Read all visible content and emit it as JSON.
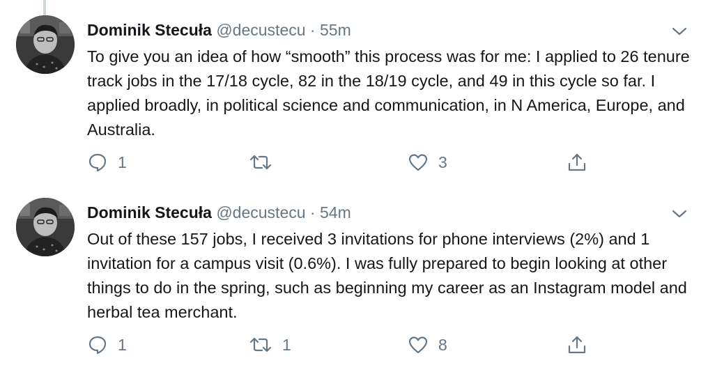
{
  "tweets": [
    {
      "author_name": "Dominik Stecuła",
      "handle": "@decustecu",
      "separator": "·",
      "time": "55m",
      "text": "To give you an idea of how “smooth” this process was for me: I applied to 26 tenure track jobs in the 17/18 cycle, 82 in the 18/19 cycle, and 49 in this cycle so far. I applied broadly, in political science and communication, in N America, Europe, and Australia.",
      "replies": "1",
      "retweets": "",
      "likes": "3"
    },
    {
      "author_name": "Dominik Stecuła",
      "handle": "@decustecu",
      "separator": "·",
      "time": "54m",
      "text": "Out of these 157 jobs, I received 3 invitations for phone interviews (2%) and 1 invitation for a campus visit (0.6%). I was fully prepared to begin looking at other things to do in the spring, such as beginning my career as an Instagram model and herbal tea merchant.",
      "replies": "1",
      "retweets": "1",
      "likes": "8"
    }
  ],
  "icons": {
    "reply": "reply-icon",
    "retweet": "retweet-icon",
    "like": "heart-icon",
    "share": "share-icon",
    "more": "chevron-down-icon"
  },
  "colors": {
    "text": "#14171a",
    "secondary": "#657786",
    "thread_line": "#ccd6dd"
  }
}
